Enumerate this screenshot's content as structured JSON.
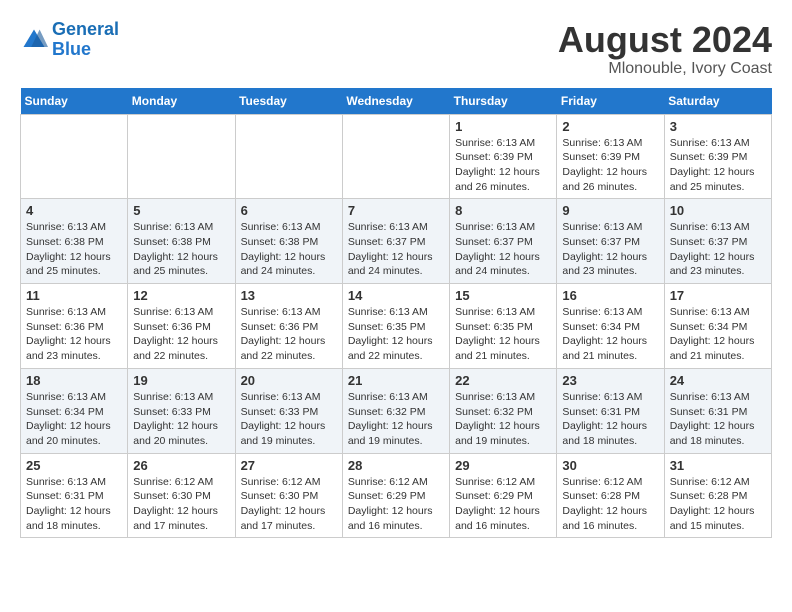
{
  "header": {
    "logo_line1": "General",
    "logo_line2": "Blue",
    "main_title": "August 2024",
    "sub_title": "Mlonouble, Ivory Coast"
  },
  "calendar": {
    "days_of_week": [
      "Sunday",
      "Monday",
      "Tuesday",
      "Wednesday",
      "Thursday",
      "Friday",
      "Saturday"
    ],
    "weeks": [
      [
        {
          "day": "",
          "detail": ""
        },
        {
          "day": "",
          "detail": ""
        },
        {
          "day": "",
          "detail": ""
        },
        {
          "day": "",
          "detail": ""
        },
        {
          "day": "1",
          "detail": "Sunrise: 6:13 AM\nSunset: 6:39 PM\nDaylight: 12 hours\nand 26 minutes."
        },
        {
          "day": "2",
          "detail": "Sunrise: 6:13 AM\nSunset: 6:39 PM\nDaylight: 12 hours\nand 26 minutes."
        },
        {
          "day": "3",
          "detail": "Sunrise: 6:13 AM\nSunset: 6:39 PM\nDaylight: 12 hours\nand 25 minutes."
        }
      ],
      [
        {
          "day": "4",
          "detail": "Sunrise: 6:13 AM\nSunset: 6:38 PM\nDaylight: 12 hours\nand 25 minutes."
        },
        {
          "day": "5",
          "detail": "Sunrise: 6:13 AM\nSunset: 6:38 PM\nDaylight: 12 hours\nand 25 minutes."
        },
        {
          "day": "6",
          "detail": "Sunrise: 6:13 AM\nSunset: 6:38 PM\nDaylight: 12 hours\nand 24 minutes."
        },
        {
          "day": "7",
          "detail": "Sunrise: 6:13 AM\nSunset: 6:37 PM\nDaylight: 12 hours\nand 24 minutes."
        },
        {
          "day": "8",
          "detail": "Sunrise: 6:13 AM\nSunset: 6:37 PM\nDaylight: 12 hours\nand 24 minutes."
        },
        {
          "day": "9",
          "detail": "Sunrise: 6:13 AM\nSunset: 6:37 PM\nDaylight: 12 hours\nand 23 minutes."
        },
        {
          "day": "10",
          "detail": "Sunrise: 6:13 AM\nSunset: 6:37 PM\nDaylight: 12 hours\nand 23 minutes."
        }
      ],
      [
        {
          "day": "11",
          "detail": "Sunrise: 6:13 AM\nSunset: 6:36 PM\nDaylight: 12 hours\nand 23 minutes."
        },
        {
          "day": "12",
          "detail": "Sunrise: 6:13 AM\nSunset: 6:36 PM\nDaylight: 12 hours\nand 22 minutes."
        },
        {
          "day": "13",
          "detail": "Sunrise: 6:13 AM\nSunset: 6:36 PM\nDaylight: 12 hours\nand 22 minutes."
        },
        {
          "day": "14",
          "detail": "Sunrise: 6:13 AM\nSunset: 6:35 PM\nDaylight: 12 hours\nand 22 minutes."
        },
        {
          "day": "15",
          "detail": "Sunrise: 6:13 AM\nSunset: 6:35 PM\nDaylight: 12 hours\nand 21 minutes."
        },
        {
          "day": "16",
          "detail": "Sunrise: 6:13 AM\nSunset: 6:34 PM\nDaylight: 12 hours\nand 21 minutes."
        },
        {
          "day": "17",
          "detail": "Sunrise: 6:13 AM\nSunset: 6:34 PM\nDaylight: 12 hours\nand 21 minutes."
        }
      ],
      [
        {
          "day": "18",
          "detail": "Sunrise: 6:13 AM\nSunset: 6:34 PM\nDaylight: 12 hours\nand 20 minutes."
        },
        {
          "day": "19",
          "detail": "Sunrise: 6:13 AM\nSunset: 6:33 PM\nDaylight: 12 hours\nand 20 minutes."
        },
        {
          "day": "20",
          "detail": "Sunrise: 6:13 AM\nSunset: 6:33 PM\nDaylight: 12 hours\nand 19 minutes."
        },
        {
          "day": "21",
          "detail": "Sunrise: 6:13 AM\nSunset: 6:32 PM\nDaylight: 12 hours\nand 19 minutes."
        },
        {
          "day": "22",
          "detail": "Sunrise: 6:13 AM\nSunset: 6:32 PM\nDaylight: 12 hours\nand 19 minutes."
        },
        {
          "day": "23",
          "detail": "Sunrise: 6:13 AM\nSunset: 6:31 PM\nDaylight: 12 hours\nand 18 minutes."
        },
        {
          "day": "24",
          "detail": "Sunrise: 6:13 AM\nSunset: 6:31 PM\nDaylight: 12 hours\nand 18 minutes."
        }
      ],
      [
        {
          "day": "25",
          "detail": "Sunrise: 6:13 AM\nSunset: 6:31 PM\nDaylight: 12 hours\nand 18 minutes."
        },
        {
          "day": "26",
          "detail": "Sunrise: 6:12 AM\nSunset: 6:30 PM\nDaylight: 12 hours\nand 17 minutes."
        },
        {
          "day": "27",
          "detail": "Sunrise: 6:12 AM\nSunset: 6:30 PM\nDaylight: 12 hours\nand 17 minutes."
        },
        {
          "day": "28",
          "detail": "Sunrise: 6:12 AM\nSunset: 6:29 PM\nDaylight: 12 hours\nand 16 minutes."
        },
        {
          "day": "29",
          "detail": "Sunrise: 6:12 AM\nSunset: 6:29 PM\nDaylight: 12 hours\nand 16 minutes."
        },
        {
          "day": "30",
          "detail": "Sunrise: 6:12 AM\nSunset: 6:28 PM\nDaylight: 12 hours\nand 16 minutes."
        },
        {
          "day": "31",
          "detail": "Sunrise: 6:12 AM\nSunset: 6:28 PM\nDaylight: 12 hours\nand 15 minutes."
        }
      ]
    ]
  }
}
